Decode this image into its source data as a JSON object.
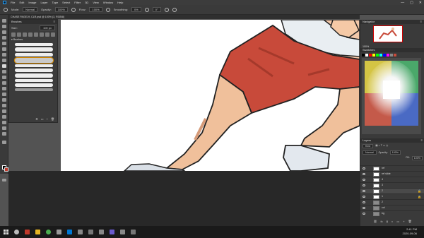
{
  "menu": [
    "File",
    "Edit",
    "Image",
    "Layer",
    "Type",
    "Select",
    "Filter",
    "3D",
    "View",
    "Window",
    "Help"
  ],
  "window_controls": [
    "—",
    "▢",
    "✕"
  ],
  "options_bar": {
    "mode": "Normal",
    "opacity": "100%",
    "flow": "100%",
    "smoothing": "0%",
    "angle": "0°"
  },
  "doc_tab": "CHASE PAGE19 .CLR.psd @ 100% (3, RGB/8)",
  "brushes": {
    "title": "Brushes",
    "size_label": "Size:",
    "size_value": "100 px",
    "folder": "Brushes",
    "swatch_count": 8
  },
  "navigator": {
    "title": "Navigator",
    "zoom": "100%"
  },
  "swatches": {
    "title": "Swatches"
  },
  "layers": {
    "title": "Layers",
    "kind": "Kind",
    "blend": "Normal",
    "opacity_label": "Opacity:",
    "opacity": "100%",
    "fill_label": "Fill:",
    "fill": "100%",
    "rows": [
      {
        "name": "ref"
      },
      {
        "name": "ref slide"
      },
      {
        "name": "4"
      },
      {
        "name": "3"
      },
      {
        "name": "2"
      },
      {
        "name": "1"
      },
      {
        "name": "2"
      },
      {
        "name": "col"
      },
      {
        "name": "bg"
      }
    ]
  },
  "taskbar": {
    "time": "2:41 PM",
    "date": "2020-09-06"
  }
}
